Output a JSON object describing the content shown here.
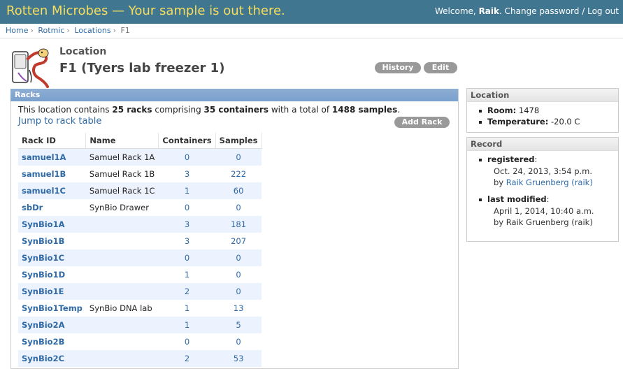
{
  "header": {
    "site_title": "Rotten Microbes — Your sample is out there.",
    "welcome": "Welcome,",
    "username": "Raik",
    "change_password": "Change password",
    "separator": "/",
    "logout": "Log out"
  },
  "breadcrumb": [
    "Home",
    "Rotmic",
    "Locations",
    "F1"
  ],
  "breadcrumb_sep": "›",
  "page": {
    "label": "Location",
    "title": "F1 (Tyers lab freezer 1)",
    "history_button": "History",
    "edit_button": "Edit"
  },
  "racks_module": {
    "header": "Racks",
    "summary_prefix": "This location contains",
    "rack_count": "25 racks",
    "summary_mid1": "comprising",
    "container_count": "35 containers",
    "summary_mid2": "with a total of",
    "sample_count": "1488 samples",
    "summary_end": ".",
    "jump_link": "Jump to rack table",
    "add_button": "Add Rack",
    "columns": [
      "Rack ID",
      "Name",
      "Containers",
      "Samples"
    ],
    "rows": [
      {
        "id": "samuel1A",
        "name": "Samuel Rack 1A",
        "containers": "0",
        "samples": "0"
      },
      {
        "id": "samuel1B",
        "name": "Samuel Rack 1B",
        "containers": "3",
        "samples": "222"
      },
      {
        "id": "samuel1C",
        "name": "Samuel Rack 1C",
        "containers": "1",
        "samples": "60"
      },
      {
        "id": "sbDr",
        "name": "SynBio Drawer",
        "containers": "0",
        "samples": "0"
      },
      {
        "id": "SynBio1A",
        "name": "",
        "containers": "3",
        "samples": "181"
      },
      {
        "id": "SynBio1B",
        "name": "",
        "containers": "3",
        "samples": "207"
      },
      {
        "id": "SynBio1C",
        "name": "",
        "containers": "0",
        "samples": "0"
      },
      {
        "id": "SynBio1D",
        "name": "",
        "containers": "1",
        "samples": "0"
      },
      {
        "id": "SynBio1E",
        "name": "",
        "containers": "2",
        "samples": "0"
      },
      {
        "id": "SynBio1Temp",
        "name": "SynBio DNA lab",
        "containers": "1",
        "samples": "13"
      },
      {
        "id": "SynBio2A",
        "name": "",
        "containers": "1",
        "samples": "5"
      },
      {
        "id": "SynBio2B",
        "name": "",
        "containers": "0",
        "samples": "0"
      },
      {
        "id": "SynBio2C",
        "name": "",
        "containers": "2",
        "samples": "53"
      }
    ]
  },
  "location_box": {
    "header": "Location",
    "room_label": "Room:",
    "room_value": "1478",
    "temp_label": "Temperature:",
    "temp_value": "-20.0 C"
  },
  "record_box": {
    "header": "Record",
    "registered_label": "registered",
    "registered_date": "Oct. 24, 2013, 3:54 p.m.",
    "by": "by",
    "registered_by": "Raik Gruenberg (raik)",
    "modified_label": "last modified",
    "modified_date": "April 1, 2014, 10:40 a.m.",
    "modified_by": "Raik Gruenberg (raik)"
  },
  "colors": {
    "topbar": "#417690",
    "site_title": "#f5dd5d",
    "module_header": "#79a0cd",
    "link": "#2f6aa6",
    "row_stripe": "#edf3fe",
    "pill_button": "#999999"
  },
  "logo": {
    "icon": "microbe-freezer-logo-icon"
  }
}
